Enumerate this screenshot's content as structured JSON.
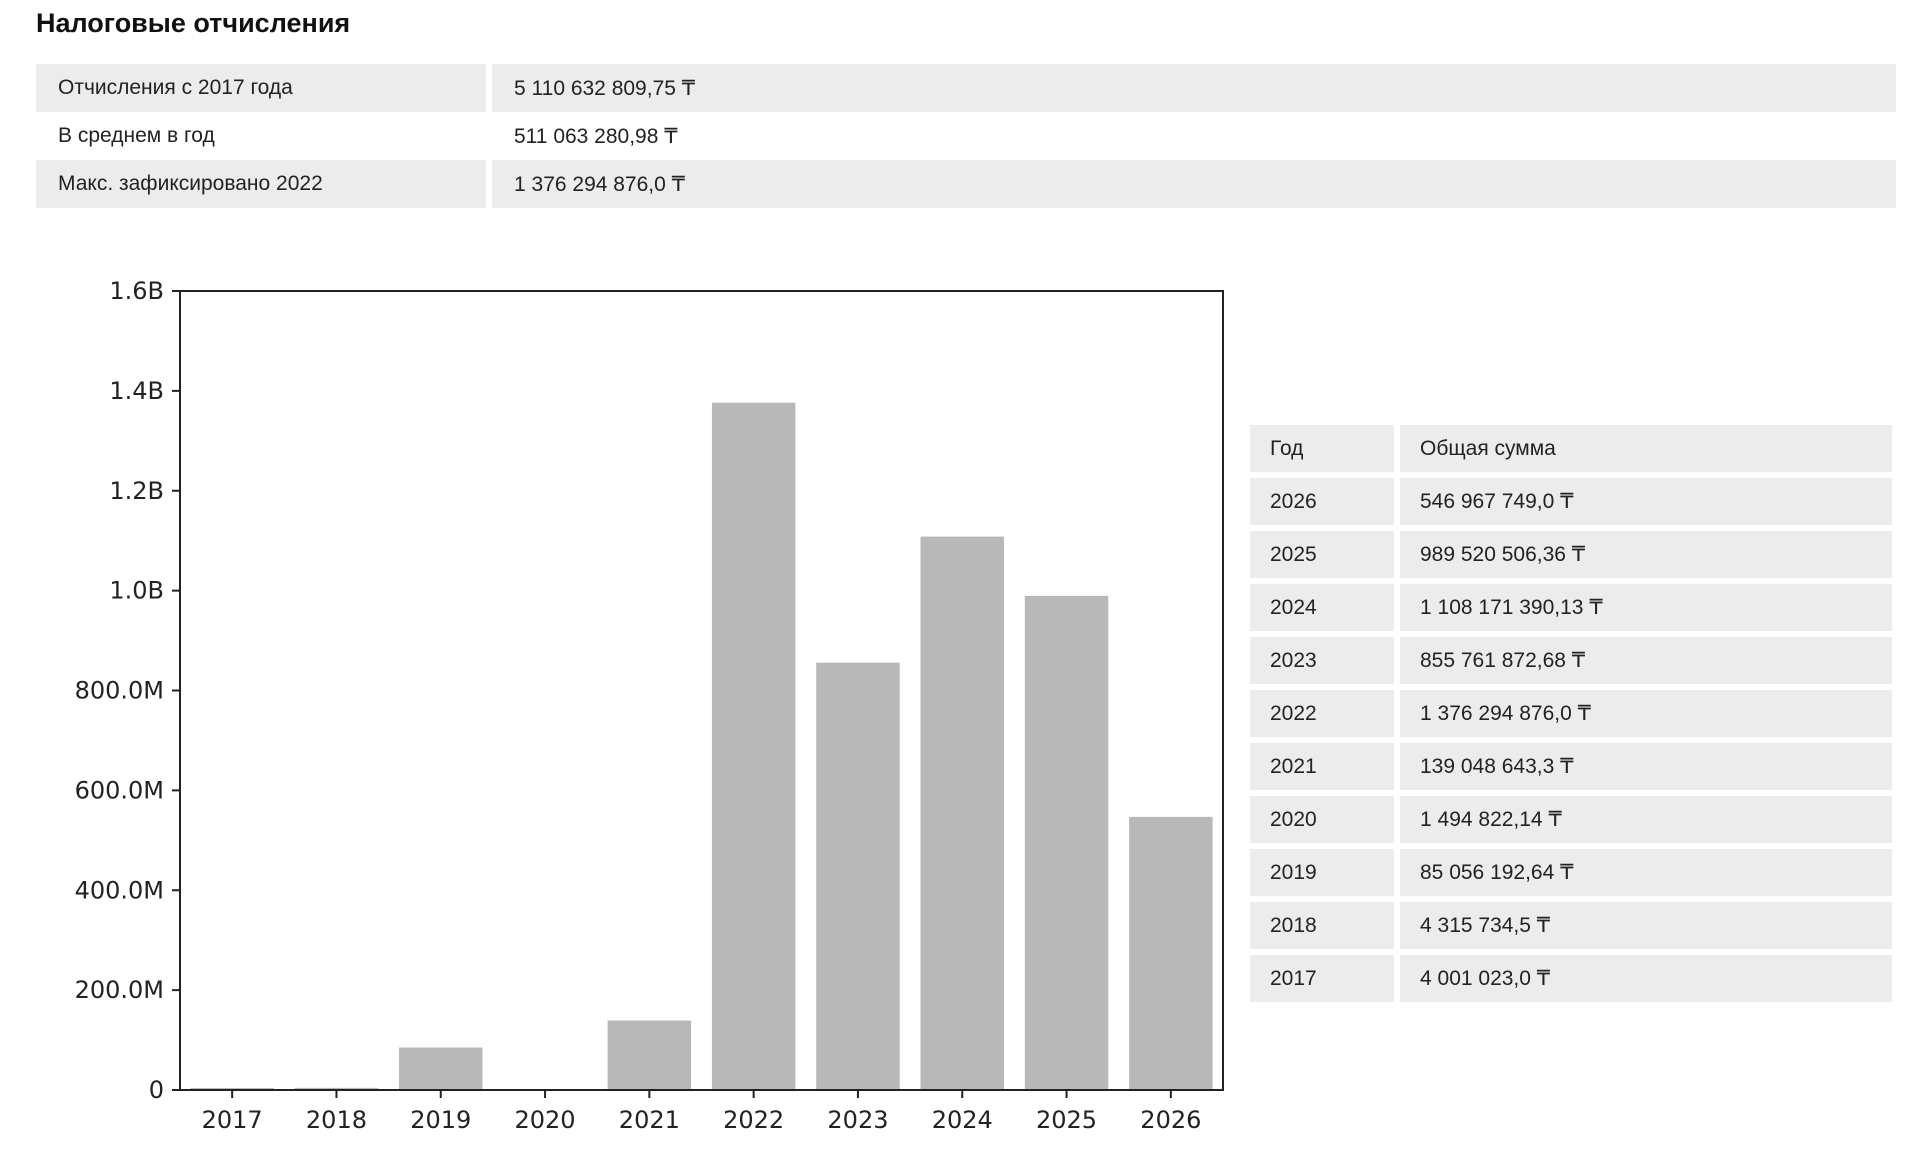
{
  "title": "Налоговые отчисления",
  "summary": [
    {
      "label": "Отчисления с 2017 года",
      "value": "5 110 632 809,75 ₸"
    },
    {
      "label": "В среднем в год",
      "value": "511 063 280,98 ₸"
    },
    {
      "label": "Макс. зафиксировано 2022",
      "value": "1 376 294 876,0 ₸"
    }
  ],
  "colors": {
    "bar": "#b8b8b8",
    "row_shade": "#ececec",
    "axis": "#222222"
  },
  "chart_data": {
    "type": "bar",
    "categories": [
      "2017",
      "2018",
      "2019",
      "2020",
      "2021",
      "2022",
      "2023",
      "2024",
      "2025",
      "2026"
    ],
    "values": [
      4001023.0,
      4315734.5,
      85056192.64,
      1494822.14,
      139048643.3,
      1376294876.0,
      855761872.68,
      1108171390.13,
      989520506.36,
      546967749.0
    ],
    "ylim": [
      0,
      1600000000
    ],
    "yticks": [
      0,
      200000000,
      400000000,
      600000000,
      800000000,
      1000000000,
      1200000000,
      1400000000,
      1600000000
    ],
    "ytick_labels": [
      "0",
      "200.0M",
      "400.0M",
      "600.0M",
      "800.0M",
      "1.0B",
      "1.2B",
      "1.4B",
      "1.6B"
    ],
    "title": "",
    "xlabel": "",
    "ylabel": "",
    "grid": false,
    "legend": false
  },
  "year_table": {
    "headers": [
      "Год",
      "Общая сумма"
    ],
    "rows": [
      {
        "year": "2026",
        "amount": "546 967 749,0 ₸"
      },
      {
        "year": "2025",
        "amount": "989 520 506,36 ₸"
      },
      {
        "year": "2024",
        "amount": "1 108 171 390,13 ₸"
      },
      {
        "year": "2023",
        "amount": "855 761 872,68 ₸"
      },
      {
        "year": "2022",
        "amount": "1 376 294 876,0 ₸"
      },
      {
        "year": "2021",
        "amount": "139 048 643,3 ₸"
      },
      {
        "year": "2020",
        "amount": "1 494 822,14 ₸"
      },
      {
        "year": "2019",
        "amount": "85 056 192,64 ₸"
      },
      {
        "year": "2018",
        "amount": "4 315 734,5 ₸"
      },
      {
        "year": "2017",
        "amount": "4 001 023,0 ₸"
      }
    ]
  }
}
